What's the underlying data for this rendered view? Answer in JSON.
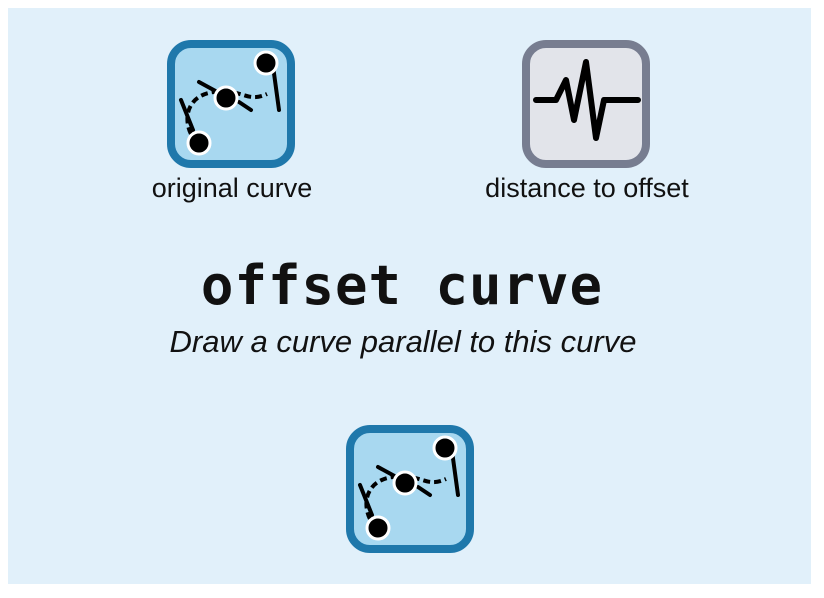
{
  "inputs": [
    {
      "label": "original curve",
      "icon": "curve-icon"
    },
    {
      "label": "distance to offset",
      "icon": "waveform-icon"
    }
  ],
  "node": {
    "title": "offset curve",
    "description": "Draw a curve parallel to this curve"
  },
  "output": {
    "icon": "curve-icon"
  },
  "colors": {
    "background": "#e1f0fa",
    "curve_fill": "#a8d8f0",
    "curve_border": "#1f78ab",
    "number_fill": "#e2e4ea",
    "number_border": "#777d90"
  }
}
